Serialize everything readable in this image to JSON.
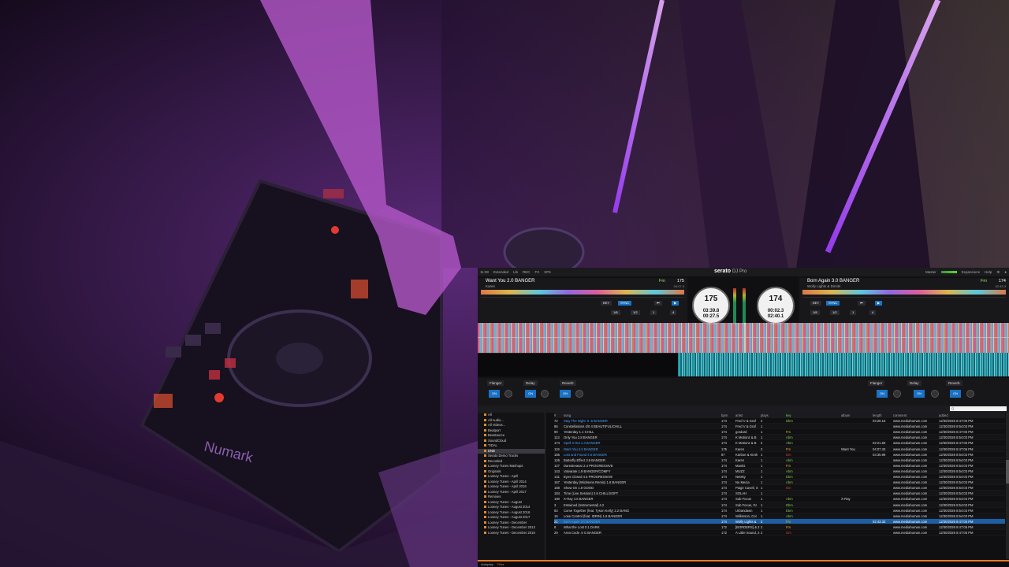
{
  "scene": {
    "controller_brand": "Numark"
  },
  "top": {
    "clock": "11:08",
    "mode": "Extended",
    "layout": "Lib",
    "rec": "REC",
    "fx": "FX",
    "sp6": "SP6",
    "brand": "serato",
    "product": "DJ Pro",
    "master": "Master",
    "expansions": "Expansions",
    "help": "Help"
  },
  "deck1": {
    "title": "Want You 2.0 BANGER",
    "artist": "Karen",
    "key": "Fm",
    "bpm": "175",
    "remaining": "04:07.3",
    "platter_bpm": "175",
    "elapsed": "03:39.8",
    "left": "00:27.5",
    "btn_key": "KEY",
    "btn_sync": "SYNC",
    "loops": [
      "1/8",
      "1/2",
      "1",
      "4"
    ]
  },
  "deck2": {
    "title": "Born Again 3.0 BANGER",
    "artist": "Wolly Lights & Dimitri",
    "key": "Fm",
    "bpm": "174",
    "remaining": "02:43.3",
    "platter_bpm": "174",
    "elapsed": "00:02.3",
    "left": "02:40.1",
    "btn_key": "KEY",
    "btn_sync": "SYNC",
    "loops": [
      "1/8",
      "1/2",
      "1",
      "4"
    ]
  },
  "fx": {
    "left": [
      "Flanger",
      "Delay",
      "Reverb"
    ],
    "right": [
      "Flanger",
      "Delay",
      "Reverb"
    ],
    "on": "ON"
  },
  "library": {
    "search_placeholder": "Q",
    "columns": [
      "#",
      "song",
      "bpm",
      "artist",
      "plays",
      "key",
      "album",
      "length",
      "comment",
      "added"
    ],
    "crates": [
      {
        "label": "All",
        "selected": false
      },
      {
        "label": "All Audio...",
        "selected": false
      },
      {
        "label": "All Videos...",
        "selected": false
      },
      {
        "label": "Beatport",
        "selected": false
      },
      {
        "label": "Beatsource",
        "selected": false
      },
      {
        "label": "SoundCloud",
        "selected": false
      },
      {
        "label": "TIDAL",
        "selected": false
      },
      {
        "label": "DNB",
        "selected": true
      },
      {
        "label": "Serato Demo Tracks",
        "selected": false
      },
      {
        "label": "Recorded",
        "selected": false
      },
      {
        "label": "Looney Tunes Mashups",
        "selected": false
      },
      {
        "label": "Originals",
        "selected": false
      },
      {
        "label": "Looney Tunes - April",
        "selected": false
      },
      {
        "label": "Looney Tunes - April 2014",
        "selected": false
      },
      {
        "label": "Looney Tunes - April 2016",
        "selected": false
      },
      {
        "label": "Looney Tunes - April 2017",
        "selected": false
      },
      {
        "label": "Remixes",
        "selected": false
      },
      {
        "label": "Looney Tunes - August",
        "selected": false
      },
      {
        "label": "Looney Tunes - August 2014",
        "selected": false
      },
      {
        "label": "Looney Tunes - August 2016",
        "selected": false
      },
      {
        "label": "Looney Tunes - August 2017",
        "selected": false
      },
      {
        "label": "Looney Tunes - December",
        "selected": false
      },
      {
        "label": "Looney Tunes - December 2013",
        "selected": false
      },
      {
        "label": "Looney Tunes - December 2016",
        "selected": false
      }
    ],
    "tracks": [
      {
        "num": "72",
        "song": "Stay The Night .5 .5 BANGER",
        "bpm": "174",
        "artist": "Fred V & Graf",
        "plays": "2",
        "key": "Dbm",
        "keyc": "g",
        "album": "",
        "length": "03:26.16",
        "comment": "www.mediahuman.com",
        "added": "12/30/2026 8:47:05 PM",
        "played": true
      },
      {
        "num": "86",
        "song": "Constellations 4/0 4 BEAUTIFUL/CHILL",
        "bpm": "174",
        "artist": "Fred V & Graf",
        "plays": "1",
        "key": "",
        "keyc": "g",
        "album": "",
        "length": "",
        "comment": "www.mediahuman.com",
        "added": "12/30/2026 8:54:03 PM",
        "played": false
      },
      {
        "num": "90",
        "song": "Yesterday 1.1 CHILL",
        "bpm": "174",
        "artist": "gordard",
        "plays": "1",
        "key": "Fm",
        "keyc": "y",
        "album": "",
        "length": "",
        "comment": "www.mediahuman.com",
        "added": "12/30/2026 8:47:05 PM",
        "played": false
      },
      {
        "num": "113",
        "song": "Only You 2.8 BANGER",
        "bpm": "174",
        "artist": "K Motionz & B",
        "plays": "1",
        "key": "Abm",
        "keyc": "g",
        "album": "",
        "length": "",
        "comment": "www.mediahuman.com",
        "added": "12/30/2026 8:54:03 PM",
        "played": false
      },
      {
        "num": "174",
        "song": "Spell It Out 1.3 BANGER",
        "bpm": "174",
        "artist": "K Motionz & B",
        "plays": "2",
        "key": "Abm",
        "keyc": "g",
        "album": "",
        "length": "02:21.56",
        "comment": "www.mediahuman.com",
        "added": "12/30/2026 8:47:05 PM",
        "played": true
      },
      {
        "num": "119",
        "song": "Want You 2.0 BANGER",
        "bpm": "175",
        "artist": "Karen",
        "plays": "2",
        "key": "Fm",
        "keyc": "y",
        "album": "Want You",
        "length": "04:07.33",
        "comment": "www.mediahuman.com",
        "added": "12/30/2026 8:47:05 PM",
        "played": true
      },
      {
        "num": "165",
        "song": "Lost and Found 4.6 BANGER",
        "bpm": "87",
        "artist": "Karboe & Kinth",
        "plays": "1",
        "key": "Dm",
        "keyc": "r",
        "album": "",
        "length": "03:35.99",
        "comment": "www.mediahuman.com",
        "added": "12/30/2026 8:54:03 PM",
        "played": true
      },
      {
        "num": "126",
        "song": "Butterfly Effect 3.6 BANGER",
        "bpm": "174",
        "artist": "Karen",
        "plays": "1",
        "key": "Abm",
        "keyc": "g",
        "album": "",
        "length": "",
        "comment": "www.mediahuman.com",
        "added": "12/30/2026 8:54:03 PM",
        "played": false
      },
      {
        "num": "127",
        "song": "Daredevasar 2.4 PROGRESSIVE",
        "bpm": "174",
        "artist": "Mantis",
        "plays": "1",
        "key": "Fm",
        "keyc": "y",
        "album": "",
        "length": "",
        "comment": "www.mediahuman.com",
        "added": "12/30/2026 8:54:03 PM",
        "played": false
      },
      {
        "num": "143",
        "song": "Valvarate 1.9 BANGER/COMFY",
        "bpm": "174",
        "artist": "MUZZ",
        "plays": "1",
        "key": "Abm",
        "keyc": "g",
        "album": "",
        "length": "",
        "comment": "www.mediahuman.com",
        "added": "12/30/2026 8:54:03 PM",
        "played": false
      },
      {
        "num": "131",
        "song": "Eyes Closed 4.5 PROGRESSIVE",
        "bpm": "174",
        "artist": "Netsky",
        "plays": "1",
        "key": "Ebm",
        "keyc": "g",
        "album": "",
        "length": "",
        "comment": "www.mediahuman.com",
        "added": "12/30/2026 8:54:03 PM",
        "played": false
      },
      {
        "num": "167",
        "song": "Yesterday (Wicksens Remix) 1.6 BANGER",
        "bpm": "174",
        "artist": "Nu Mecia",
        "plays": "1",
        "key": "Abm",
        "keyc": "g",
        "album": "",
        "length": "",
        "comment": "www.mediahuman.com",
        "added": "12/30/2026 8:54:03 PM",
        "played": false
      },
      {
        "num": "168",
        "song": "Show On 1.8 GOOD",
        "bpm": "174",
        "artist": "Paige Cavell, S",
        "plays": "1",
        "key": "Dm",
        "keyc": "r",
        "album": "",
        "length": "",
        "comment": "www.mediahuman.com",
        "added": "12/30/2026 8:54:03 PM",
        "played": false
      },
      {
        "num": "184",
        "song": "Time (Live Session) 2.6 CHILL/SOFT",
        "bpm": "174",
        "artist": "SOLAH",
        "plays": "1",
        "key": "",
        "keyc": "g",
        "album": "",
        "length": "",
        "comment": "www.mediahuman.com",
        "added": "12/30/2026 8:54:03 PM",
        "played": false
      },
      {
        "num": "190",
        "song": "X-Ray 4.6 BANGER",
        "bpm": "174",
        "artist": "Sub Focus",
        "plays": "1",
        "key": "Abm",
        "keyc": "g",
        "album": "X-Ray",
        "length": "",
        "comment": "www.mediahuman.com",
        "added": "12/30/2026 8:54:03 PM",
        "played": false
      },
      {
        "num": "3",
        "song": "Entwined (Instrumental) 4.2",
        "bpm": "174",
        "artist": "Sub Focus, Gr",
        "plays": "1",
        "key": "Dbm",
        "keyc": "g",
        "album": "",
        "length": "",
        "comment": "www.mediahuman.com",
        "added": "12/30/2026 8:54:03 PM",
        "played": false
      },
      {
        "num": "83",
        "song": "Come Together (feat. Tyson Kelly) 2.2 BANG",
        "bpm": "174",
        "artist": "Urbandawn",
        "plays": "1",
        "key": "Ebm",
        "keyc": "g",
        "album": "",
        "length": "",
        "comment": "www.mediahuman.com",
        "added": "12/30/2026 8:54:03 PM",
        "played": false
      },
      {
        "num": "16",
        "song": "Lose Control (feat. IDRIN) 1.6 BANGER",
        "bpm": "174",
        "artist": "Wilkinson, Cor",
        "plays": "1",
        "key": "Abm",
        "keyc": "g",
        "album": "",
        "length": "",
        "comment": "www.mediahuman.com",
        "added": "12/30/2026 8:54:03 PM",
        "played": false
      },
      {
        "num": "21",
        "song": "Born Again 3.0 BANGER",
        "bpm": "174",
        "artist": "Wolly Lights &",
        "plays": "2",
        "key": "Fm",
        "keyc": "y",
        "album": "",
        "length": "02:43.33",
        "comment": "www.mediahuman.com",
        "added": "12/30/2026 8:47:05 PM",
        "played": true,
        "selected": true
      },
      {
        "num": "8",
        "song": "What the Lost 0.1 DARK",
        "bpm": "172",
        "artist": "[BORDERS] & 2",
        "plays": "2",
        "key": "Fm",
        "keyc": "y",
        "album": "",
        "length": "",
        "comment": "www.mediahuman.com",
        "added": "12/30/2026 8:47:05 PM",
        "played": false
      },
      {
        "num": "29",
        "song": "Area Code .5 G BANGER",
        "bpm": "172",
        "artist": "A Little Sound, 2",
        "plays": "2",
        "key": "Gm",
        "keyc": "r",
        "album": "",
        "length": "",
        "comment": "www.mediahuman.com",
        "added": "12/30/2026 8:47:05 PM",
        "played": false
      }
    ]
  },
  "status": {
    "left": "Autoplay",
    "tab": "Files"
  }
}
